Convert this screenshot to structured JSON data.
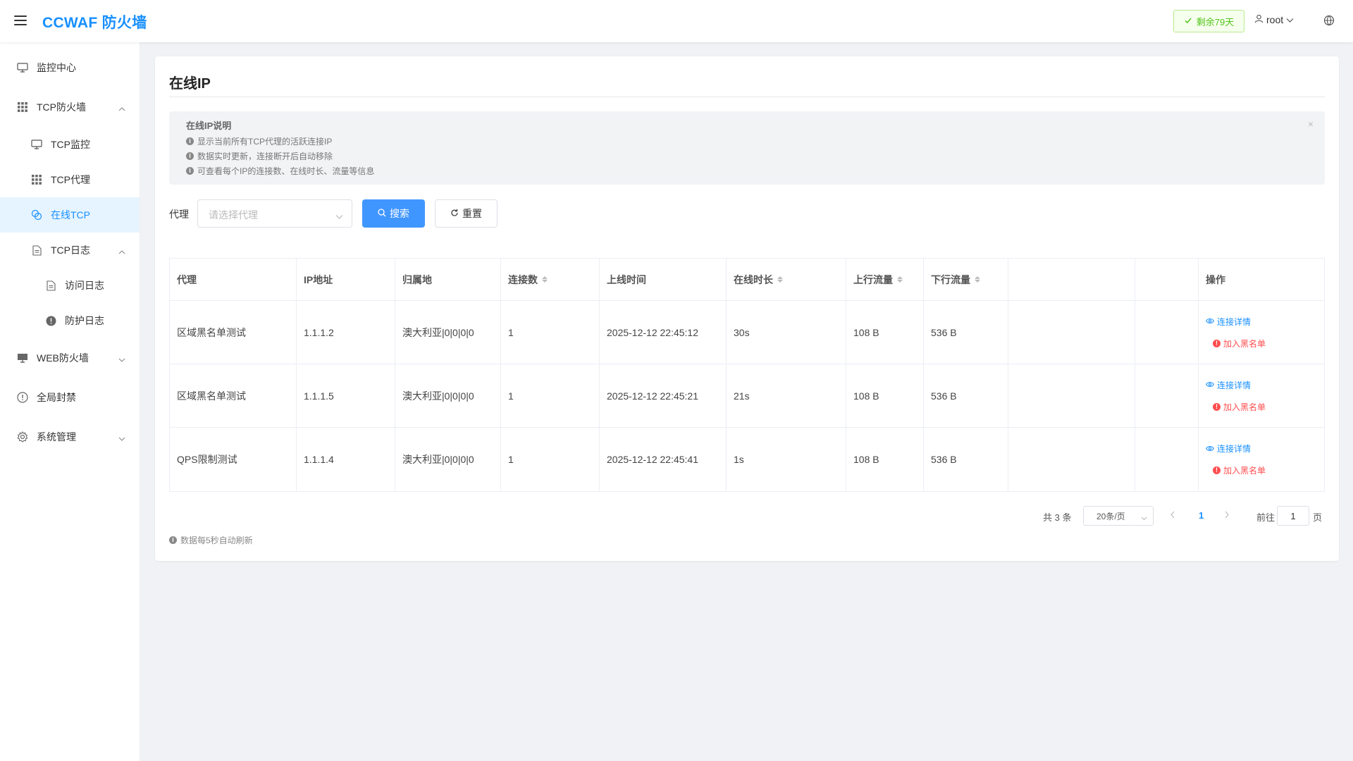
{
  "header": {
    "logo": "CCWAF 防火墙",
    "days_badge": "剩余79天",
    "user": "root",
    "icons": [
      "hamburger-icon",
      "check-icon",
      "user-icon",
      "chevron-down-icon",
      "globe-icon"
    ]
  },
  "sidebar": {
    "items": [
      {
        "label": "监控中心",
        "icon": "monitor-icon"
      },
      {
        "label": "TCP防火墙",
        "icon": "grid-icon"
      },
      {
        "label": "TCP监控",
        "icon": "monitor-icon"
      },
      {
        "label": "TCP代理",
        "icon": "grid-icon"
      },
      {
        "label": "在线TCP",
        "icon": "link-icon"
      },
      {
        "label": "TCP日志",
        "icon": "document-icon"
      },
      {
        "label": "访问日志",
        "icon": "document-icon"
      },
      {
        "label": "防护日志",
        "icon": "alert-icon"
      },
      {
        "label": "WEB防火墙",
        "icon": "desktop-icon"
      },
      {
        "label": "全局封禁",
        "icon": "warning-icon"
      },
      {
        "label": "系统管理",
        "icon": "gear-icon"
      }
    ],
    "active_color": "#1890ff"
  },
  "main": {
    "title": "在线IP",
    "alert": {
      "title": "在线IP说明",
      "lines": [
        "显示当前所有TCP代理的活跃连接IP",
        "数据实时更新，连接断开后自动移除",
        "可查看每个IP的连接数、在线时长、流量等信息"
      ]
    },
    "filter": {
      "label": "代理",
      "placeholder": "请选择代理",
      "search_label": "搜索",
      "reset_label": "重置"
    },
    "table": {
      "headers": [
        "代理",
        "IP地址",
        "归属地",
        "连接数",
        "上线时间",
        "在线时长",
        "上行流量",
        "下行流量",
        "",
        "",
        "操作"
      ],
      "rows": [
        [
          "区域黑名单测试",
          "1.1.1.2",
          "澳大利亚|0|0|0|0",
          "1",
          "2025-12-12 22:45:12",
          "30s",
          "108 B",
          "536 B"
        ],
        [
          "区域黑名单测试",
          "1.1.1.5",
          "澳大利亚|0|0|0|0",
          "1",
          "2025-12-12 22:45:21",
          "21s",
          "108 B",
          "536 B"
        ],
        [
          "QPS限制测试",
          "1.1.1.4",
          "澳大利亚|0|0|0|0",
          "1",
          "2025-12-12 22:45:41",
          "1s",
          "108 B",
          "536 B"
        ]
      ],
      "action_detail": "连接详情",
      "action_blacklist": "加入黑名单"
    },
    "pagination": {
      "total": "共 3 条",
      "page_size": "20条/页",
      "current": "1",
      "goto_label": "前往",
      "goto_value": "1",
      "unit": "页"
    },
    "footer_note": "数据每5秒自动刷新"
  }
}
